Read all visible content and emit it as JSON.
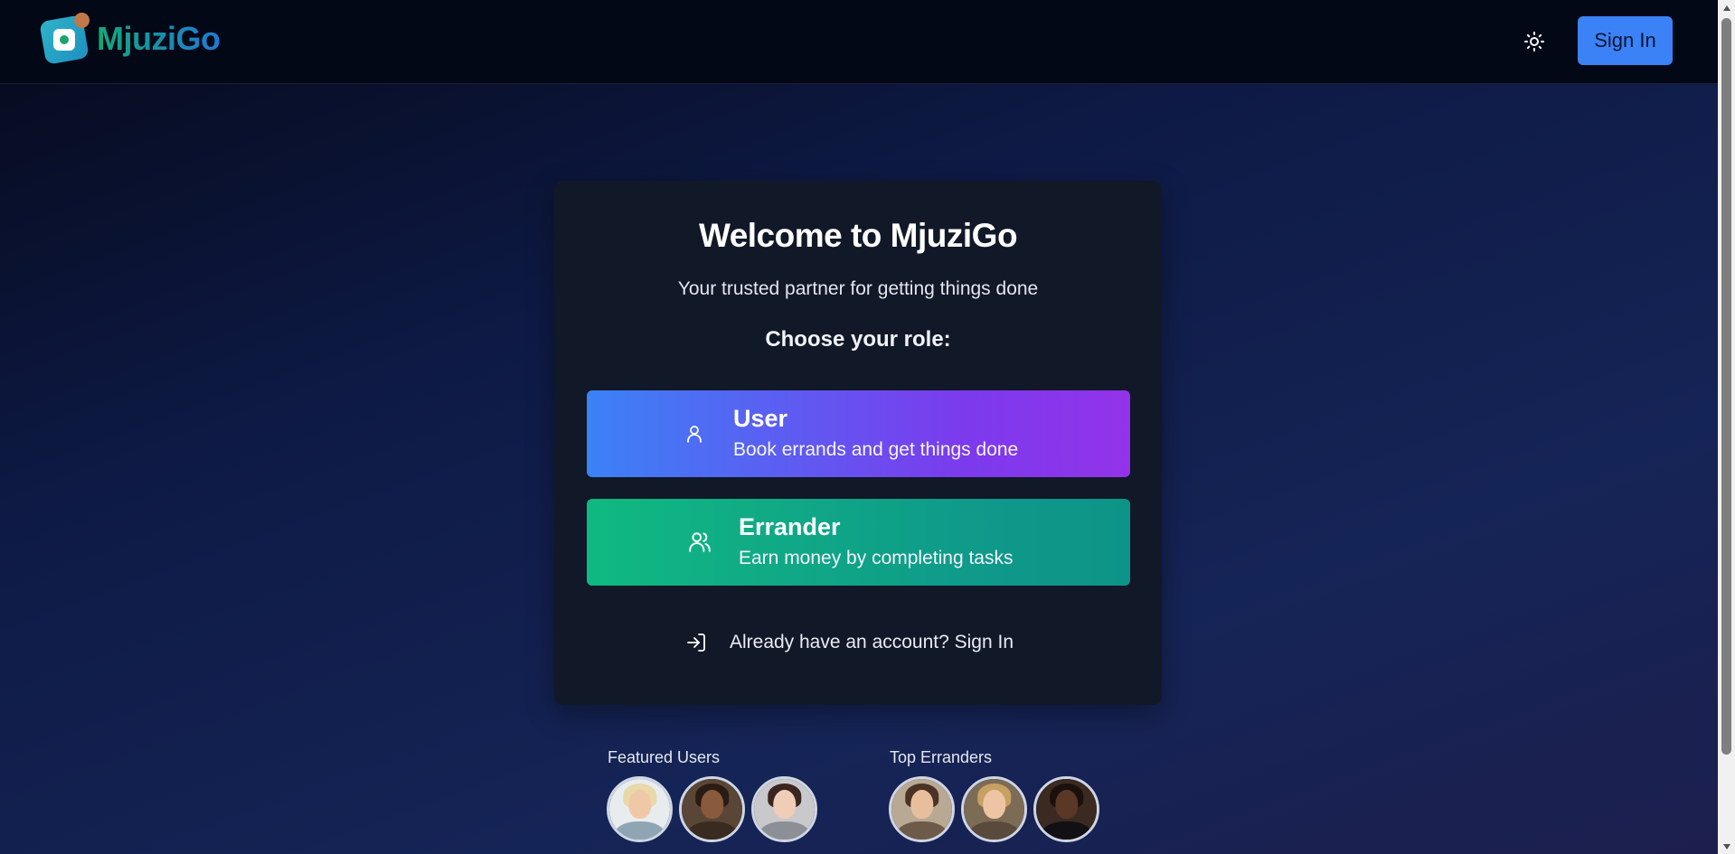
{
  "header": {
    "logo_text": "MjuziGo",
    "theme_toggle_icon": "sun-icon",
    "sign_in_label": "Sign In"
  },
  "card": {
    "title": "Welcome to MjuziGo",
    "subtitle": "Your trusted partner for getting things done",
    "role_prompt": "Choose your role:",
    "roles": [
      {
        "title": "User",
        "description": "Book errands and get things done",
        "icon": "user-icon",
        "gradient": [
          "#3b82f6",
          "#9333ea"
        ]
      },
      {
        "title": "Errander",
        "description": "Earn money by completing tasks",
        "icon": "users-icon",
        "gradient": [
          "#10b981",
          "#0d9488"
        ]
      }
    ],
    "sign_in_link": "Already have an account? Sign In",
    "sign_in_link_icon": "log-in-icon"
  },
  "featured": {
    "users_label": "Featured Users",
    "erranders_label": "Top Erranders"
  },
  "colors": {
    "primary": "#3b82f6",
    "card_background": "#111827",
    "header_background": "#030816"
  }
}
